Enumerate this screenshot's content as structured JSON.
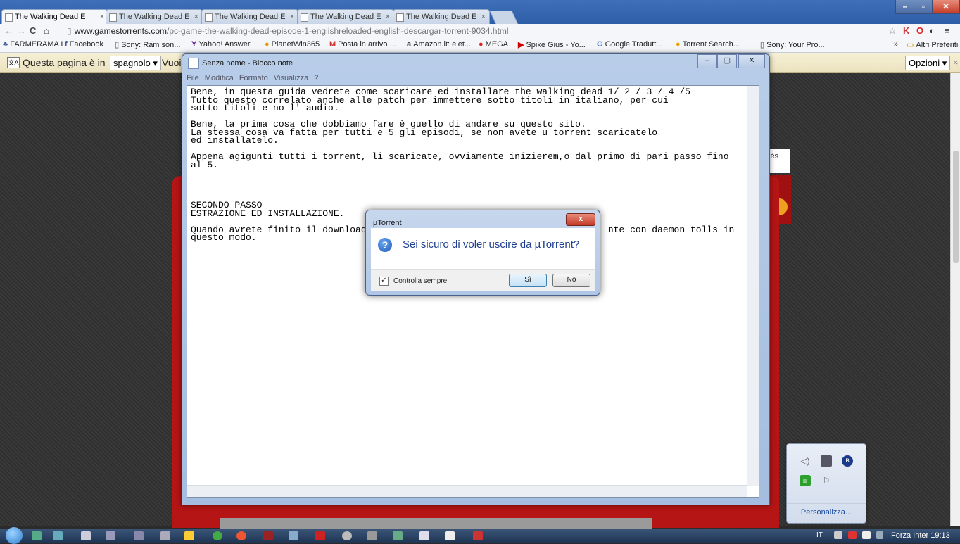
{
  "browser": {
    "tabs": [
      {
        "label": "The Walking Dead E",
        "close": "×"
      },
      {
        "label": "The Walking Dead E",
        "close": "×"
      },
      {
        "label": "The Walking Dead E",
        "close": "×"
      },
      {
        "label": "The Walking Dead E",
        "close": "×"
      },
      {
        "label": "The Walking Dead E",
        "close": "×"
      }
    ],
    "url_domain": "www.gamestorrents.com",
    "url_path": "/pc-game-the-walking-dead-episode-1-englishreloaded-english-descargar-torrent-9034.html",
    "bookmarks": [
      "FARMERAMA I",
      "Facebook",
      "Sony: Ram son...",
      "Yahoo! Answer...",
      "PlanetWin365",
      "Posta in arrivo ...",
      "Amazon.it: elet...",
      "MEGA",
      "Spike Gius - Yo...",
      "Google Tradutt...",
      "Torrent Search...",
      "Sony: Your Pro..."
    ],
    "bookmarks_overflow": "»",
    "other_bookmarks": "Altri Preferiti"
  },
  "translate_bar": {
    "text": "Questa pagina è in",
    "language": "spagnolo",
    "truncated": "Vuoi",
    "options": "Opzioni"
  },
  "page": {
    "espanol_fragment": "iés"
  },
  "notepad": {
    "title": "Senza nome - Blocco note",
    "menu": [
      "File",
      "Modifica",
      "Formato",
      "Visualizza",
      "?"
    ],
    "text": "Bene, in questa guida vedrete come scaricare ed installare the walking dead 1/ 2 / 3 / 4 /5\nTutto questo correlato anche alle patch per immettere sotto titoli in italiano, per cui\nsotto titoli e no l' audio.\n\nBene, la prima cosa che dobbiamo fare è quello di andare su questo sito.\nLa stessa cosa va fatta per tutti e 5 gli episodi, se non avete u torrent scaricatelo\ned installatelo.\n\nAppena agigunti tutti i torrent, li scaricate, ovviamente inizierem,o dal primo di pari passo fino\nal 5.\n\n\n\n\nSECONDO PASSO\nESTRAZIONE ED INSTALLAZIONE.\n\nQuando avrete finito il download                                            nte con daemon tolls in\nquesto modo."
  },
  "dialog": {
    "title": "µTorrent",
    "message": "Sei sicuro di voler uscire da µTorrent?",
    "checkbox_label": "Controlla sempre",
    "checkbox_checked": true,
    "yes": "Sì",
    "no": "No",
    "close": "x"
  },
  "tray": {
    "customize": "Personalizza..."
  },
  "taskbar": {
    "lang": "IT",
    "clock": "Forza Inter 19:13"
  }
}
